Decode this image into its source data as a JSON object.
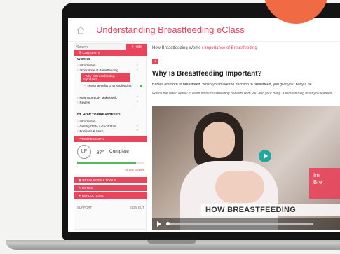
{
  "app": {
    "course_title": "Understanding Breastfeeding eClass"
  },
  "sidebar": {
    "search_placeholder": "Search",
    "hide_label": "Hide",
    "contents_label": "CONTENTS",
    "section1_title": "WORKS",
    "section1_items": [
      {
        "label": "Introduction",
        "state": "done"
      },
      {
        "label": "Importance of Breastfeeding",
        "state": "done"
      },
      {
        "label": "Why Is Breastfeeding Important?",
        "state": "current"
      },
      {
        "label": "Health Benefits of Breastfeeding",
        "state": "todo"
      },
      {
        "label": "How Your Body Makes Milk",
        "state": "done"
      },
      {
        "label": "Review",
        "state": "done"
      }
    ],
    "section2_title": "03. HOW TO BREASTFEED",
    "section2_items": [
      {
        "label": "Introduction",
        "state": "none"
      },
      {
        "label": "Getting Off to a Good Start",
        "state": "done"
      },
      {
        "label": "Positions & Latch",
        "state": "done"
      }
    ],
    "progress_label": "PROGRESS 87%",
    "avatar_initials": "LF",
    "progress_value": "87",
    "progress_unit": "%",
    "progress_fraction": 0.87,
    "complete_label": "Complete",
    "show_details": "Show Details",
    "resources_label": "RESOURCES & TOOLS",
    "notes_label": "NOTES",
    "reflections_label": "REFLECTIONS",
    "support_label": "SUPPORT",
    "signout_label": "SIGN OUT"
  },
  "main": {
    "breadcrumb_parent": "How Breastfeeding Works",
    "breadcrumb_sep": " / ",
    "breadcrumb_current": "Importance of Breastfeeding",
    "lesson_title": "Why Is Breastfeeding Important?",
    "intro_text": "Babies are born to breastfeed. When you make the decision to breastfeed, you give your baby a he",
    "instruction_text": "Watch the video below to learn how breastfeeding benefits both you and your baby. After watching what you learned",
    "video": {
      "overlay_line1": "Im",
      "overlay_line2": "Bre",
      "caption": "HOW BREASTFEEDING"
    }
  },
  "colors": {
    "accent": "#e8445c",
    "success": "#5bb65b",
    "play": "#21a7a0",
    "brand_orange": "#f06a44"
  },
  "icons": [
    "home-icon",
    "play-icon",
    "check-icon",
    "chevron-left-icon"
  ]
}
